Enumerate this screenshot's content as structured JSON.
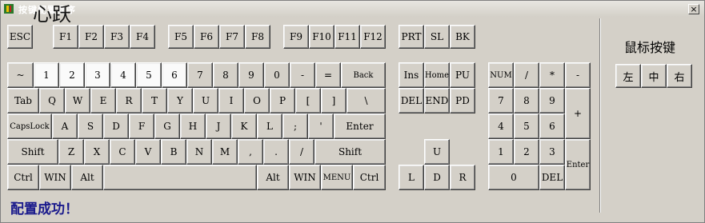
{
  "window": {
    "title": "按键配置程序",
    "overlay_title": "心跃",
    "close": "×"
  },
  "mouse": {
    "label": "鼠标按键",
    "buttons": [
      "左",
      "中",
      "右"
    ]
  },
  "status": "配置成功！",
  "highlighted_keys": [
    "1",
    "2",
    "3",
    "4",
    "5",
    "6"
  ],
  "keys": {
    "esc": "ESC",
    "f1": "F1",
    "f2": "F2",
    "f3": "F3",
    "f4": "F4",
    "f5": "F5",
    "f6": "F6",
    "f7": "F7",
    "f8": "F8",
    "f9": "F9",
    "f10": "F10",
    "f11": "F11",
    "f12": "F12",
    "prt": "PRT",
    "sl": "SL",
    "bk": "BK",
    "grave": "~",
    "n1": "1",
    "n2": "2",
    "n3": "3",
    "n4": "4",
    "n5": "5",
    "n6": "6",
    "n7": "7",
    "n8": "8",
    "n9": "9",
    "n0": "0",
    "minus": "-",
    "equal": "=",
    "back": "Back",
    "tab": "Tab",
    "q": "Q",
    "w": "W",
    "e": "E",
    "r": "R",
    "t": "T",
    "y": "Y",
    "u": "U",
    "i": "I",
    "o": "O",
    "p": "P",
    "lbracket": "[",
    "rbracket": "]",
    "backslash": "\\",
    "caps": "CapsLock",
    "a": "A",
    "s": "S",
    "d": "D",
    "f": "F",
    "g": "G",
    "h": "H",
    "j": "J",
    "k": "K",
    "l": "L",
    "semicolon": ";",
    "quote": "'",
    "enter": "Enter",
    "lshift": "Shift",
    "z": "Z",
    "x": "X",
    "c": "C",
    "v": "V",
    "b": "B",
    "n": "N",
    "m": "M",
    "comma": ",",
    "period": ".",
    "slash": "/",
    "rshift": "Shift",
    "lctrl": "Ctrl",
    "lwin": "WIN",
    "lalt": "Alt",
    "ralt": "Alt",
    "rwin": "WIN",
    "menu": "MENU",
    "rctrl": "Ctrl",
    "ins": "Ins",
    "home": "Home",
    "pu": "PU",
    "del": "DEL",
    "end": "END",
    "pd": "PD",
    "up": "U",
    "left": "L",
    "down": "D",
    "right": "R",
    "num": "NUM",
    "kp_div": "/",
    "kp_mul": "*",
    "kp_minus": "-",
    "kp7": "7",
    "kp8": "8",
    "kp9": "9",
    "kp_plus": "+",
    "kp4": "4",
    "kp5": "5",
    "kp6": "6",
    "kp1": "1",
    "kp2": "2",
    "kp3": "3",
    "kp_enter": "Enter",
    "kp0": "0",
    "kp_del": "DEL"
  }
}
